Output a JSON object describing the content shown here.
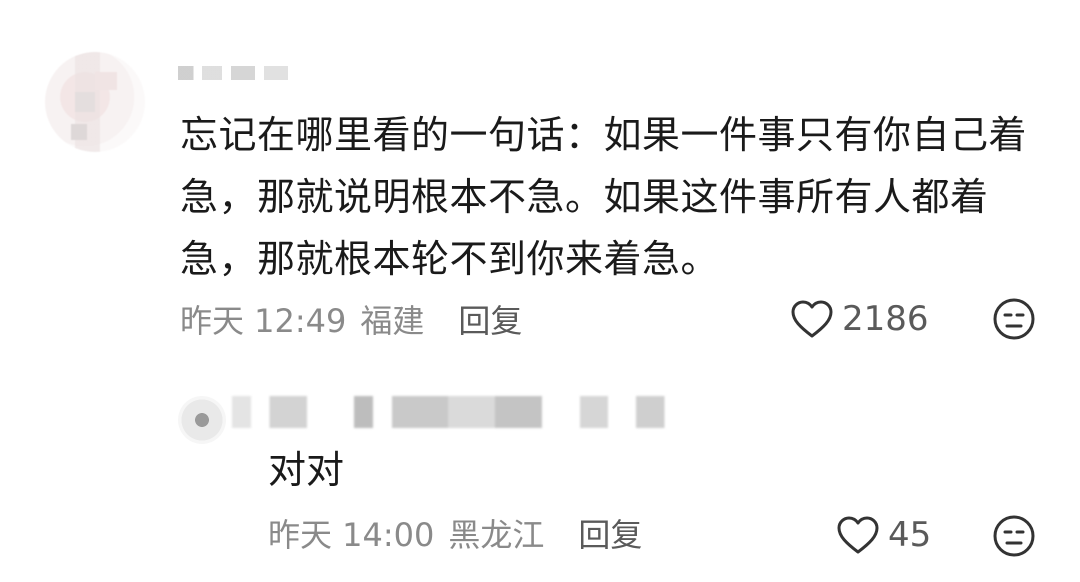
{
  "comment": {
    "text_lines": [
      "忘记在哪里看的一句话：如果一件事只有你自己着",
      "急，那就说明根本不急。如果这件事所有人都着",
      "急，那就根本轮不到你来着急。"
    ],
    "time": "昨天 12:49",
    "location": "福建",
    "reply_label": "回复",
    "likes": "2186"
  },
  "reply": {
    "text": "对对",
    "time": "昨天 14:00",
    "location": "黑龙江",
    "reply_label": "回复",
    "likes": "45"
  },
  "icons": {
    "like": "heart-outline-icon",
    "dislike": "neutral-face-icon"
  },
  "colors": {
    "text": "#1a1a1a",
    "meta": "#8a8a8a",
    "icon": "#333333"
  }
}
